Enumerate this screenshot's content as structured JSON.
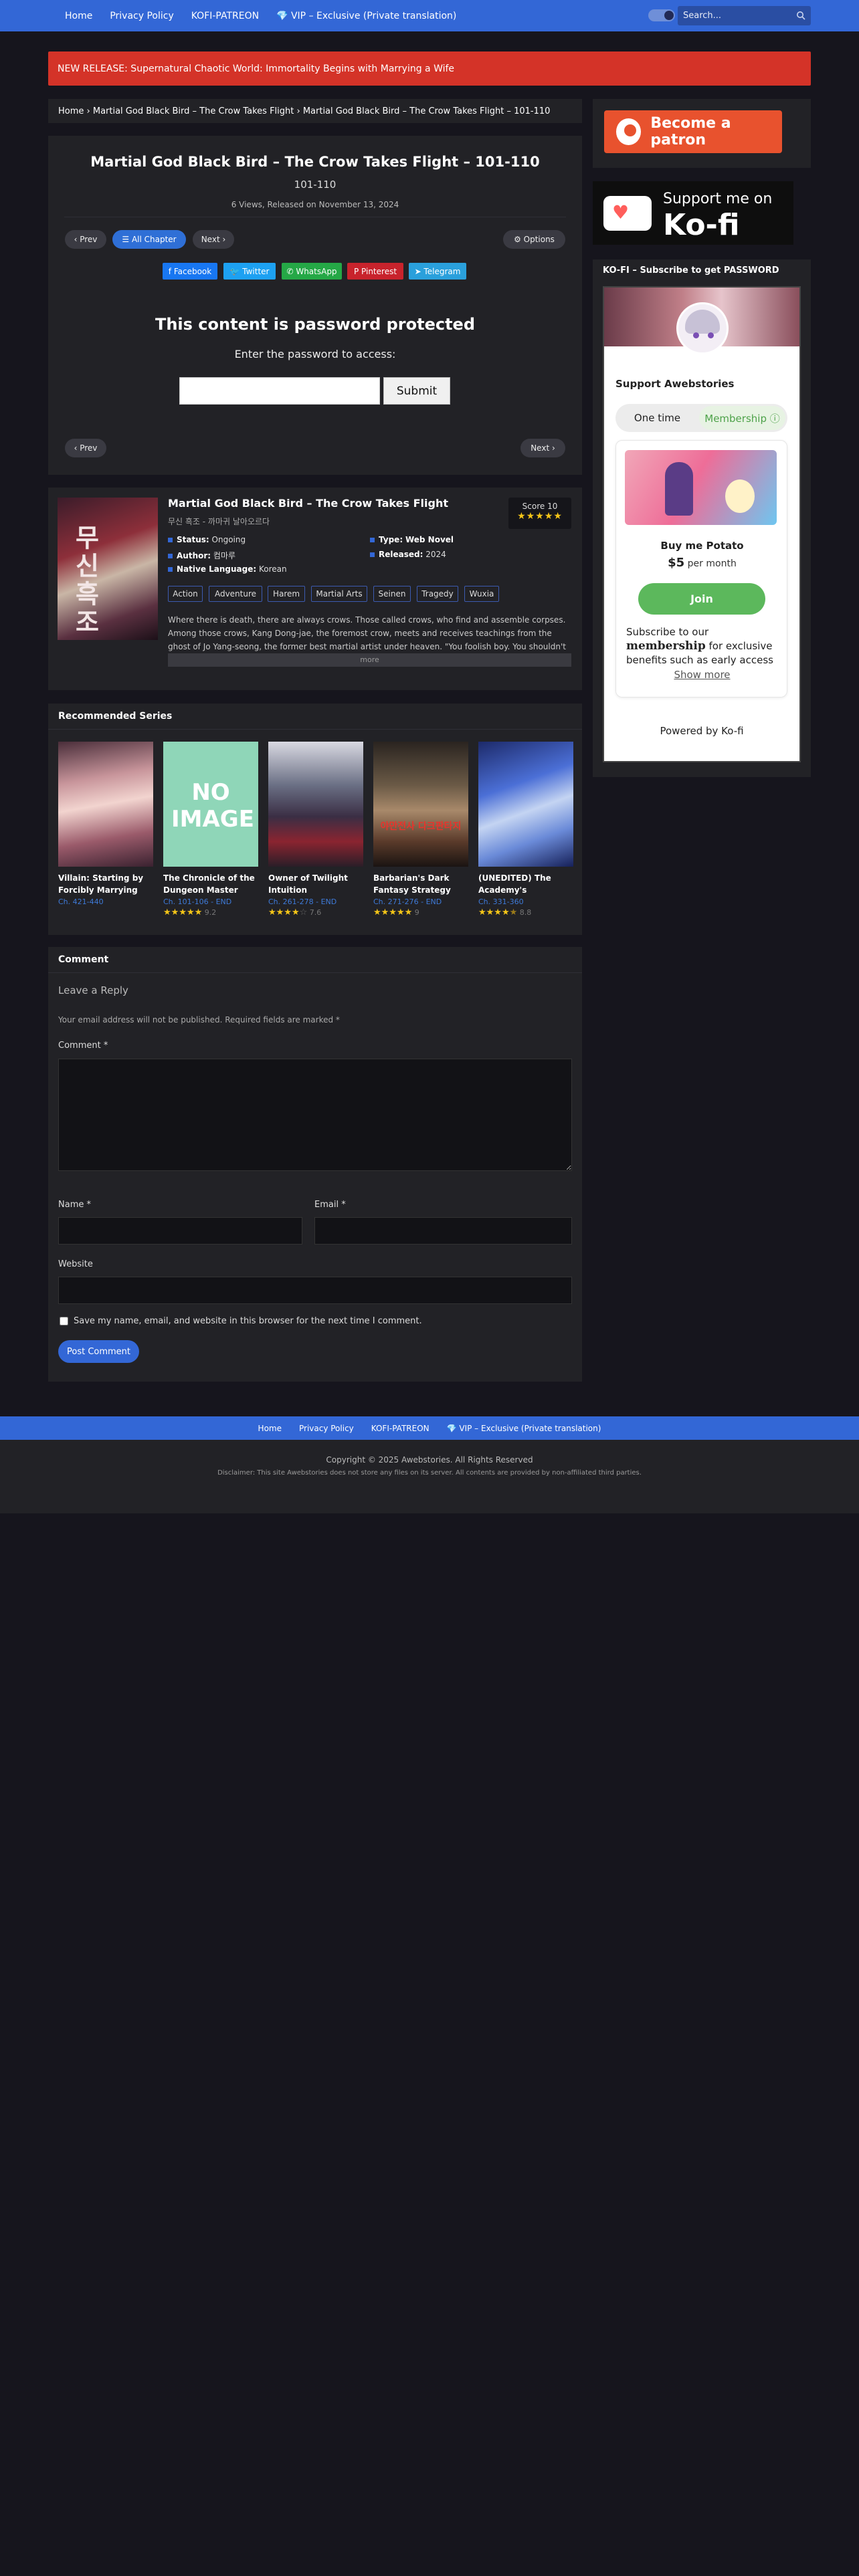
{
  "nav": {
    "items": [
      "Home",
      "Privacy Policy",
      "KOFI-PATREON",
      "💎 VIP – Exclusive (Private translation)"
    ],
    "search_placeholder": "Search..."
  },
  "announcement": "NEW RELEASE: Supernatural Chaotic World: Immortality Begins with Marrying a Wife",
  "breadcrumb": "Home › Martial God Black Bird – The Crow Takes Flight › Martial God Black Bird – The Crow Takes Flight – 101-110",
  "chapter": {
    "title": "Martial God Black Bird – The Crow Takes Flight – 101-110",
    "subtitle": "101-110",
    "meta": "6 Views, Released on November 13, 2024",
    "prev": "‹ Prev",
    "all": "☰ All Chapter",
    "next": "Next ›",
    "options": "⚙ Options",
    "share": [
      "f Facebook",
      "🐦 Twitter",
      "✆ WhatsApp",
      "P Pinterest",
      "➤ Telegram"
    ],
    "protected_title": "This content is password protected",
    "protected_label": "Enter the password to access:",
    "submit": "Submit",
    "bottom_prev": "‹ Prev",
    "bottom_next": "Next ›"
  },
  "novel": {
    "title": "Martial God Black Bird – The Crow Takes Flight",
    "alt_title": "무신 흑조 - 까마귀 날아오르다",
    "cover_text": "무신흑조",
    "score_label": "Score 10",
    "score_value": 10,
    "status_label": "Status:",
    "status": "Ongoing",
    "type_label": "Type:",
    "type": "Web Novel",
    "author_label": "Author:",
    "author": "컴마루",
    "released_label": "Released:",
    "released": "2024",
    "language_label": "Native Language:",
    "language": "Korean",
    "genres": [
      "Action",
      "Adventure",
      "Harem",
      "Martial Arts",
      "Seinen",
      "Tragedy",
      "Wuxia"
    ],
    "synopsis": "Where there is death, there are always crows. Those called crows, who find and assemble corpses. Among those crows, Kang Dong-jae, the foremost crow, meets and receives teachings from the ghost of Jo Yang-seong, the former best martial artist under heaven. \"You foolish boy. You shouldn't be",
    "more": "more"
  },
  "recommended": {
    "title": "Recommended Series",
    "items": [
      {
        "name": "Villain: Starting by Forcibly Marrying the...",
        "chapters": "Ch. 421-440",
        "rating_text": "",
        "rating": 0
      },
      {
        "name": "The Chronicle of the Dungeon Master of...",
        "chapters": "Ch. 101-106 - END",
        "rating_text": "9.2",
        "rating": 9.2
      },
      {
        "name": "Owner of Twilight Intuition",
        "chapters": "Ch. 261-278 - END",
        "rating_text": "7.6",
        "rating": 7.6
      },
      {
        "name": "Barbarian's Dark Fantasy Strategy Guide",
        "chapters": "Ch. 271-276 - END",
        "rating_text": "9",
        "rating": 9
      },
      {
        "name": "(UNEDITED) The Academy's Weakest...",
        "chapters": "Ch. 331-360",
        "rating_text": "8.8",
        "rating": 8.8
      }
    ],
    "no_image": "NO IMAGE",
    "cover_kr_text": "야만전사 다크판타지"
  },
  "comment": {
    "title": "Comment",
    "leave": "Leave a Reply",
    "note": "Your email address will not be published. Required fields are marked *",
    "comment_label": "Comment *",
    "name_label": "Name *",
    "email_label": "Email *",
    "website_label": "Website",
    "save_label": "Save my name, email, and website in this browser for the next time I comment.",
    "post": "Post Comment"
  },
  "sidebar": {
    "patron": "Become a patron",
    "kofi_support_line": "Support me on",
    "kofi_brand": "Ko-fi",
    "kofi_widget_title": "KO-FI – Subscribe to get PASSWORD",
    "support_name": "Support Awebstories",
    "tab_one": "One time",
    "tab_membership": "Membership ⓘ",
    "tier_name": "Buy me Potato",
    "tier_price": "$5",
    "tier_period": " per month",
    "join": "Join",
    "desc_a": "Subscribe to our",
    "desc_b": "membership",
    "desc_c": " for exclusive benefits such as early access",
    "show_more": "Show more",
    "powered": "Powered by Ko-fi"
  },
  "footer": {
    "copyright": "Copyright © 2025 Awebstories. All Rights Reserved",
    "disclaimer": "Disclaimer: This site Awebstories does not store any files on its server. All contents are provided by non-affiliated third parties."
  },
  "colors": {
    "nav": "#3367d6",
    "announce": "#d43328",
    "patreon": "#e8522e",
    "kofi_green": "#5cb85c",
    "star": "#f5c518"
  }
}
